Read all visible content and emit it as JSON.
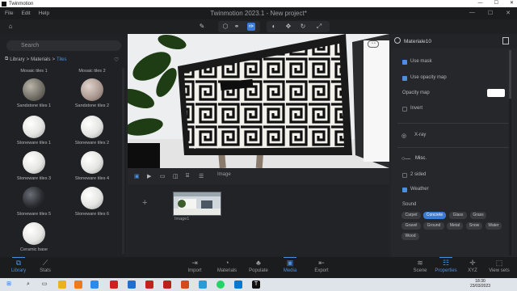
{
  "window": {
    "app_name": "Twinmotion",
    "minimize": "—",
    "maximize": "☐",
    "close": "✕"
  },
  "menu": {
    "items": [
      "File",
      "Edit",
      "Help"
    ],
    "project_title": "Twinmotion 2023.1 - New project*"
  },
  "library": {
    "search_placeholder": "Search",
    "breadcrumb": {
      "root": "Library",
      "sep1": ">",
      "mid": "Materials",
      "sep2": ">",
      "current": "Tiles"
    },
    "tiles": [
      {
        "label": "Mosaic tiles 1"
      },
      {
        "label": "Mosaic tiles 2"
      },
      {
        "label": "Sandstone tiles 1"
      },
      {
        "label": "Sandstone tiles 2"
      },
      {
        "label": "Stoneware tiles 1"
      },
      {
        "label": "Stoneware tiles 2"
      },
      {
        "label": "Stoneware tiles 3"
      },
      {
        "label": "Stoneware tiles 4"
      },
      {
        "label": "Stoneware tiles 5"
      },
      {
        "label": "Stoneware tiles 6"
      },
      {
        "label": "Ceramic base"
      }
    ]
  },
  "media": {
    "section_label": "Image",
    "thumb_label": "Image1"
  },
  "material": {
    "title": "Materiale10",
    "use_mask": "Use mask",
    "use_opacity_map": "Use opacity map",
    "opacity_map": "Opacity map",
    "invert": "Invert",
    "xray": "X-ray",
    "misc": "Misc.",
    "two_sided": "2 sided",
    "weather": "Weather",
    "sound_label": "Sound",
    "sounds": [
      "Carpet",
      "Concrete",
      "Glass",
      "Grass",
      "Gravel",
      "Ground",
      "Metal",
      "Snow",
      "Water",
      "Wood"
    ],
    "active_sound": "Concrete"
  },
  "dock": {
    "left": [
      {
        "label": "Library",
        "active": true
      },
      {
        "label": "Stats",
        "active": false
      }
    ],
    "center": [
      {
        "label": "Import",
        "active": false
      },
      {
        "label": "Materials",
        "active": false
      },
      {
        "label": "Populate",
        "active": false
      },
      {
        "label": "Media",
        "active": true
      },
      {
        "label": "Export",
        "active": false
      }
    ],
    "right": [
      {
        "label": "Scene",
        "active": false
      },
      {
        "label": "Properties",
        "active": true
      },
      {
        "label": "XYZ",
        "active": false
      },
      {
        "label": "View sets",
        "active": false
      }
    ]
  },
  "taskbar": {
    "time": "18:30",
    "date": "23/03/2023"
  },
  "colors": {
    "accent": "#3a7bd5",
    "panel": "#202124",
    "viewport_bg": "#ffffff"
  }
}
